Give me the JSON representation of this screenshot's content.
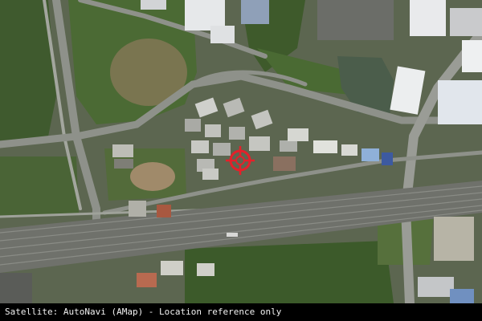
{
  "caption": "Satellite: AutoNavi (AMap) - Location reference only",
  "marker": {
    "icon": "crosshair-target-icon",
    "color": "#e5202a"
  },
  "colors": {
    "vegetation": "#3d5a2c",
    "road": "#8b8f86",
    "rail": "#7a7c76",
    "water": "#4a5a48",
    "roof_light": "#e6e8ea",
    "roof_blue": "#8fb0d8"
  }
}
